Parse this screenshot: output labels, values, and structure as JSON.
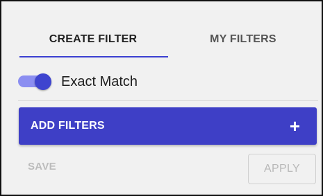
{
  "tabs": [
    {
      "label": "CREATE FILTER",
      "active": true
    },
    {
      "label": "MY FILTERS",
      "active": false
    }
  ],
  "exact_match": {
    "label": "Exact Match",
    "enabled": true
  },
  "add_filters": {
    "label": "ADD FILTERS",
    "icon": "plus-icon",
    "icon_glyph": "+"
  },
  "actions": {
    "save_label": "SAVE",
    "apply_label": "APPLY",
    "save_enabled": false,
    "apply_enabled": false
  },
  "colors": {
    "accent": "#3e3fc6",
    "toggle_track": "#8b8ef1",
    "toggle_thumb": "#3e44cf",
    "background": "#f1f1f1",
    "disabled_text": "#bcbcbc"
  }
}
